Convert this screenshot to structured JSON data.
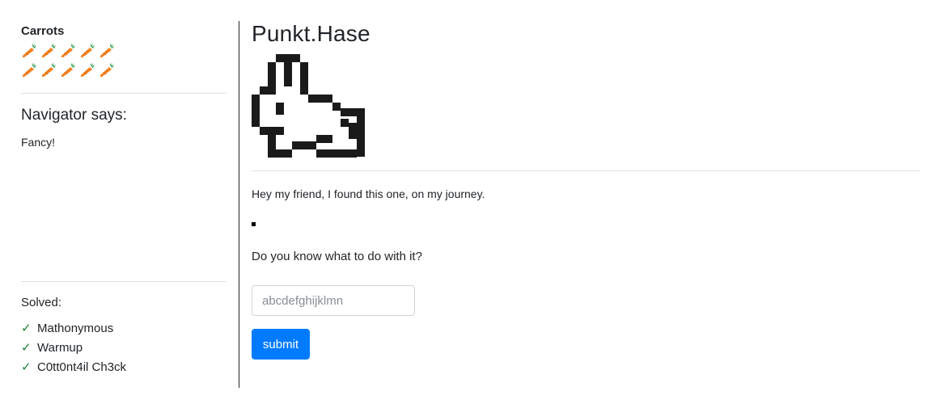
{
  "sidebar": {
    "carrots_title": "Carrots",
    "carrot_count": 10,
    "carrot_icon": "carrot-icon",
    "navigator_title": "Navigator says:",
    "navigator_text": "Fancy!",
    "solved_title": "Solved:",
    "solved_items": [
      {
        "check": "✓",
        "label": "Mathonymous"
      },
      {
        "check": "✓",
        "label": "Warmup"
      },
      {
        "check": "✓",
        "label": "C0tt0nt4il Ch3ck"
      }
    ]
  },
  "main": {
    "title": "Punkt.Hase",
    "logo_icon": "pixel-rabbit-icon",
    "intro": "Hey my friend, I found this one, on my journey.",
    "question": "Do you know what to do with it?",
    "input_placeholder": "abcdefghijklmn",
    "input_value": "",
    "submit_label": "submit"
  },
  "colors": {
    "accent": "#007bff",
    "check": "#1e7e34",
    "carrot_orange": "#f4811f",
    "carrot_green": "#2e9e4f",
    "text": "#212529"
  }
}
